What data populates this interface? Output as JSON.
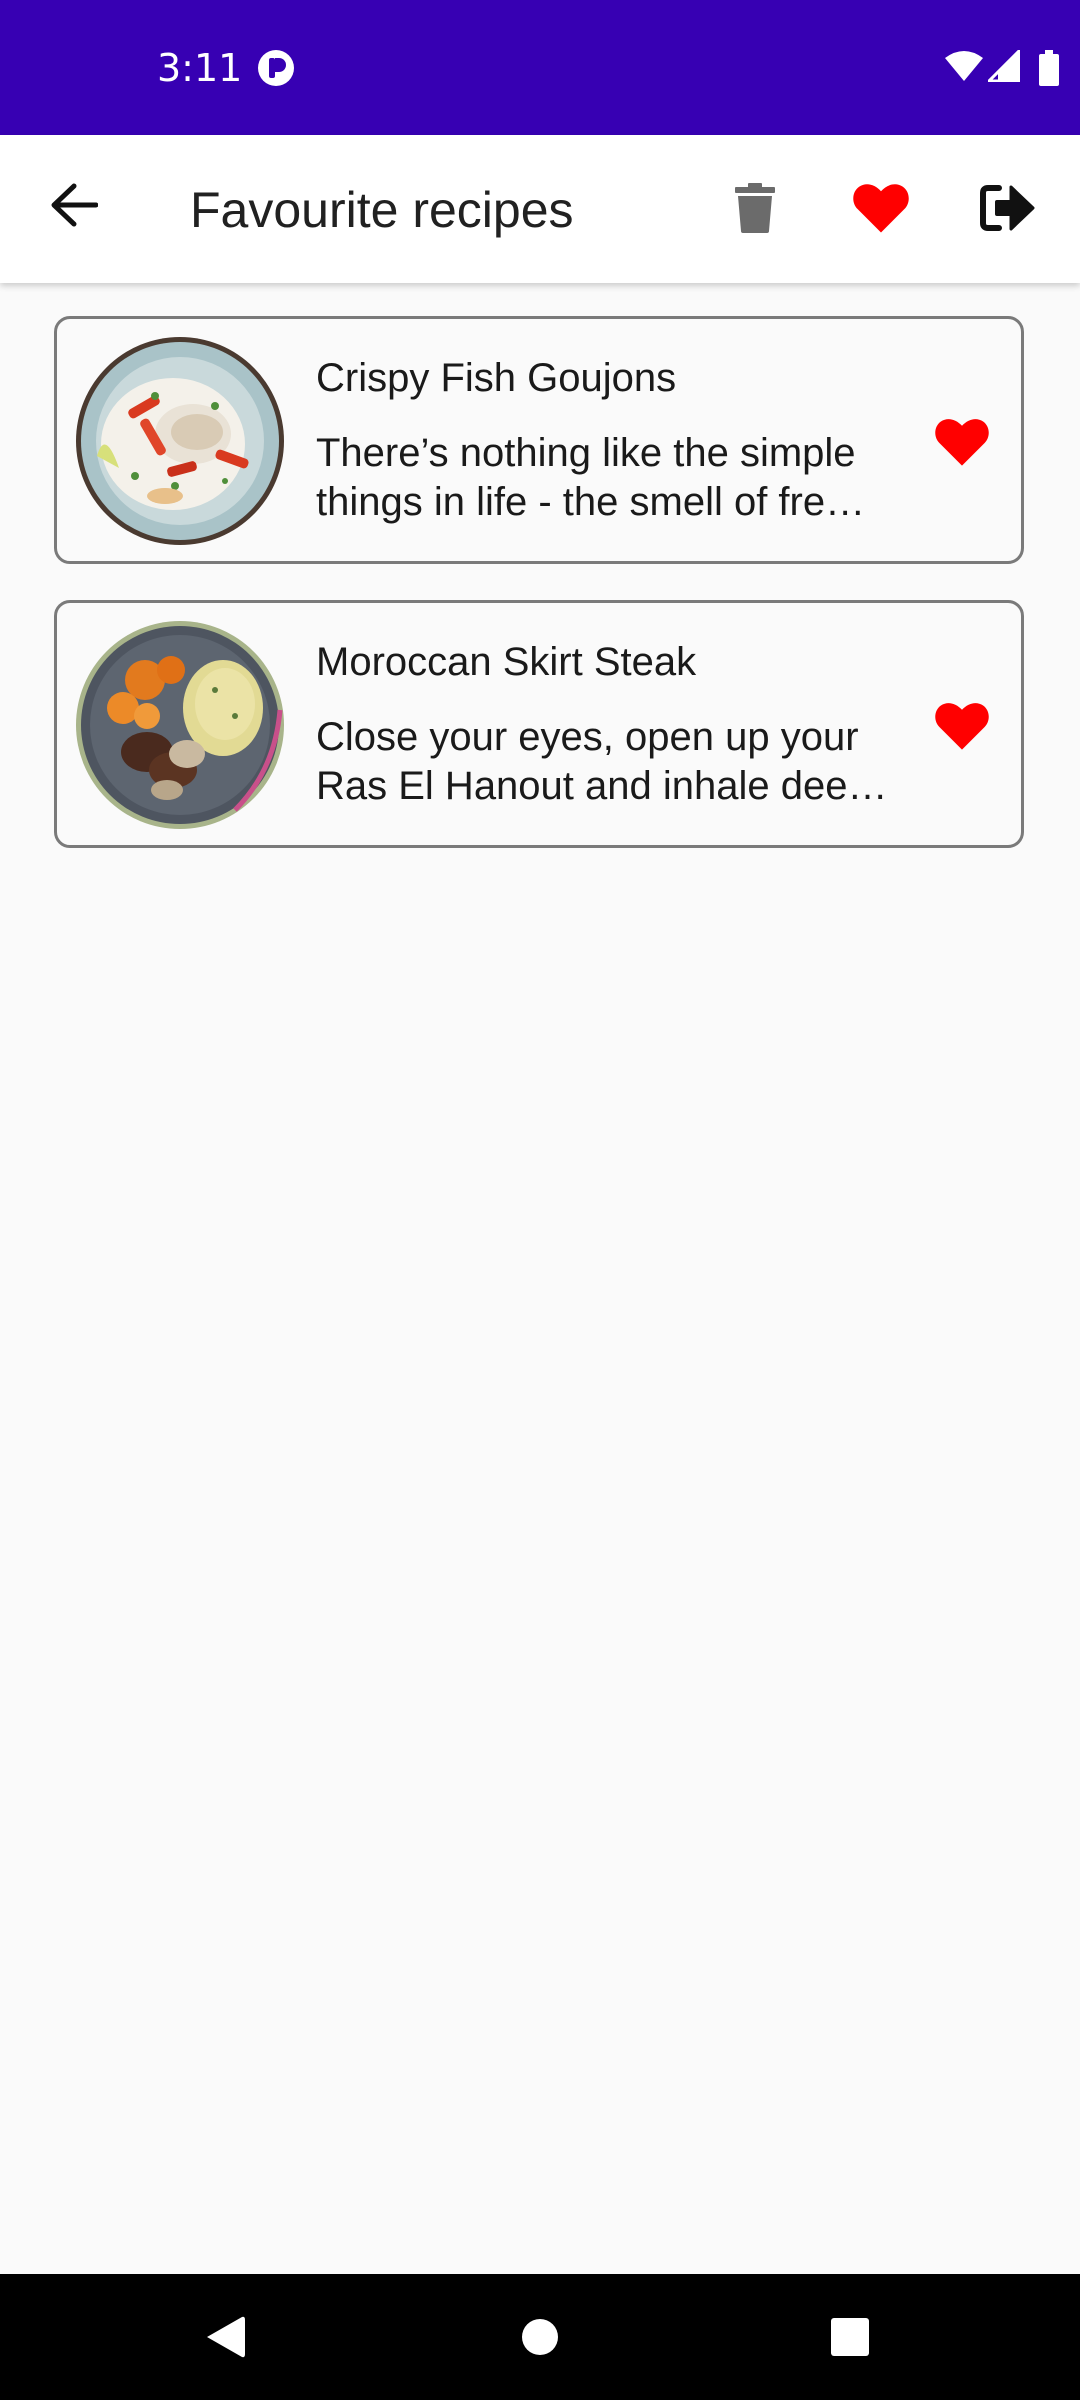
{
  "status_bar": {
    "time": "3:11",
    "background": "#3700b3"
  },
  "app_bar": {
    "title": "Favourite recipes",
    "icons": {
      "back": "arrow-left-icon",
      "delete": "trash-icon",
      "favorites": "heart-icon",
      "logout": "sign-out-icon"
    },
    "accent": "#ff0000"
  },
  "recipes": [
    {
      "name": "Crispy Fish Goujons",
      "description_line1": "There’s nothing like the simple",
      "description_line2": "things in life - the smell of fre…",
      "favorite": true
    },
    {
      "name": "Moroccan Skirt Steak",
      "description_line1": "Close your eyes, open up your",
      "description_line2": "Ras El Hanout and inhale dee…",
      "favorite": true
    }
  ],
  "nav_bar": {
    "icons": [
      "back-triangle-icon",
      "home-circle-icon",
      "recents-square-icon"
    ]
  }
}
